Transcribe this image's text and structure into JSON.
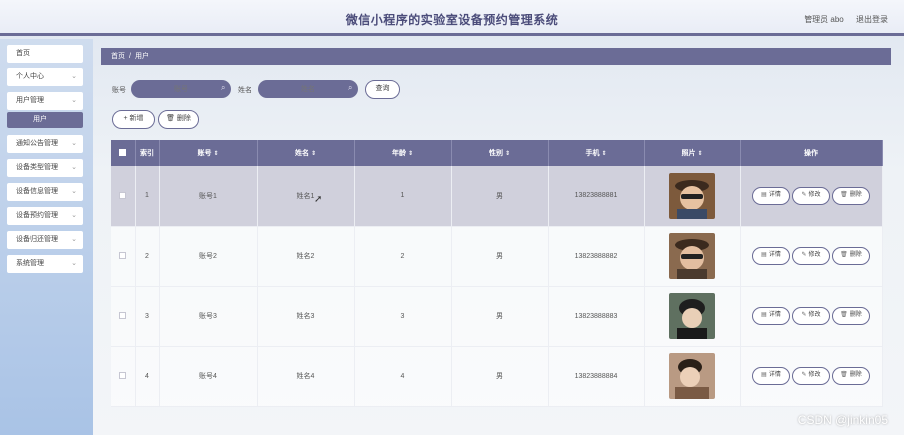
{
  "app": {
    "title": "微信小程序的实验室设备预约管理系统",
    "user_label": "管理员 abo",
    "logout_label": "退出登录"
  },
  "sidebar": {
    "items": [
      {
        "label": "首页",
        "has_chevron": false
      },
      {
        "label": "个人中心",
        "has_chevron": true
      },
      {
        "label": "用户管理",
        "has_chevron": true
      },
      {
        "label": "通知公告管理",
        "has_chevron": true
      },
      {
        "label": "设备类型管理",
        "has_chevron": true
      },
      {
        "label": "设备信息管理",
        "has_chevron": true
      },
      {
        "label": "设备预约管理",
        "has_chevron": true
      },
      {
        "label": "设备归还管理",
        "has_chevron": true
      },
      {
        "label": "系统管理",
        "has_chevron": true
      }
    ],
    "active_sub": "用户"
  },
  "breadcrumb": {
    "home": "首页",
    "separator": "/",
    "current": "用户"
  },
  "search": {
    "account_label": "账号",
    "account_placeholder": "账号",
    "name_label": "姓名",
    "name_placeholder": "姓名",
    "query_button": "查询",
    "add_button": "新增",
    "delete_button": "删除"
  },
  "table": {
    "headers": [
      "索引",
      "账号",
      "姓名",
      "年龄",
      "性别",
      "手机",
      "照片",
      "操作"
    ],
    "rows": [
      {
        "index": "1",
        "account": "账号1",
        "name": "姓名1",
        "age": "1",
        "gender": "男",
        "phone": "13823888881",
        "selected": true
      },
      {
        "index": "2",
        "account": "账号2",
        "name": "姓名2",
        "age": "2",
        "gender": "男",
        "phone": "13823888882",
        "selected": false
      },
      {
        "index": "3",
        "account": "账号3",
        "name": "姓名3",
        "age": "3",
        "gender": "男",
        "phone": "13823888883",
        "selected": false
      },
      {
        "index": "4",
        "account": "账号4",
        "name": "姓名4",
        "age": "4",
        "gender": "男",
        "phone": "13823888884",
        "selected": false
      }
    ],
    "actions": {
      "detail": "详情",
      "edit": "修改",
      "delete": "删除"
    }
  },
  "watermark": "CSDN @jinkin05",
  "colors": {
    "accent": "#6b6c96",
    "sidebar_top": "#cfdcee",
    "sidebar_bottom": "#a9c3e6",
    "selected_row": "#d0d0dc"
  },
  "icons": {
    "search": "search-icon",
    "add": "plus-icon",
    "delete": "trash-icon",
    "detail": "document-icon",
    "edit": "pencil-icon",
    "chevron": "chevron-down-icon",
    "sort": "sort-icon"
  }
}
